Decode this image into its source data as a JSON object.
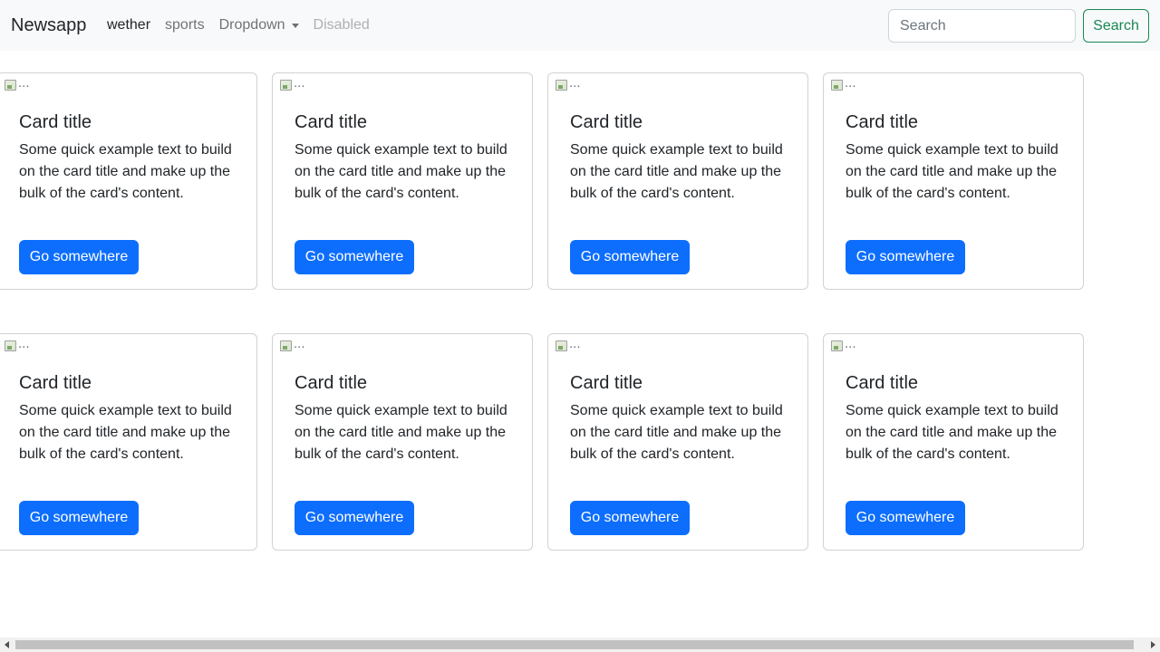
{
  "navbar": {
    "brand": "Newsapp",
    "links": [
      {
        "label": "wether",
        "state": "active"
      },
      {
        "label": "sports",
        "state": "normal"
      },
      {
        "label": "Dropdown",
        "state": "normal"
      },
      {
        "label": "Disabled",
        "state": "disabled"
      }
    ],
    "search_placeholder": "Search",
    "search_button": "Search"
  },
  "cards": [
    {
      "img_alt": "...",
      "title": "Card title",
      "text": "Some quick example text to build on the card title and make up the bulk of the card's content.",
      "button": "Go somewhere"
    },
    {
      "img_alt": "...",
      "title": "Card title",
      "text": "Some quick example text to build on the card title and make up the bulk of the card's content.",
      "button": "Go somewhere"
    },
    {
      "img_alt": "...",
      "title": "Card title",
      "text": "Some quick example text to build on the card title and make up the bulk of the card's content.",
      "button": "Go somewhere"
    },
    {
      "img_alt": "...",
      "title": "Card title",
      "text": "Some quick example text to build on the card title and make up the bulk of the card's content.",
      "button": "Go somewhere"
    },
    {
      "img_alt": "...",
      "title": "Card title",
      "text": "Some quick example text to build on the card title and make up the bulk of the card's content.",
      "button": "Go somewhere"
    },
    {
      "img_alt": "...",
      "title": "Card title",
      "text": "Some quick example text to build on the card title and make up the bulk of the card's content.",
      "button": "Go somewhere"
    },
    {
      "img_alt": "...",
      "title": "Card title",
      "text": "Some quick example text to build on the card title and make up the bulk of the card's content.",
      "button": "Go somewhere"
    },
    {
      "img_alt": "...",
      "title": "Card title",
      "text": "Some quick example text to build on the card title and make up the bulk of the card's content.",
      "button": "Go somewhere"
    }
  ],
  "colors": {
    "primary": "#0d6efd",
    "success": "#198754",
    "navbar_bg": "#f8f9fa"
  }
}
